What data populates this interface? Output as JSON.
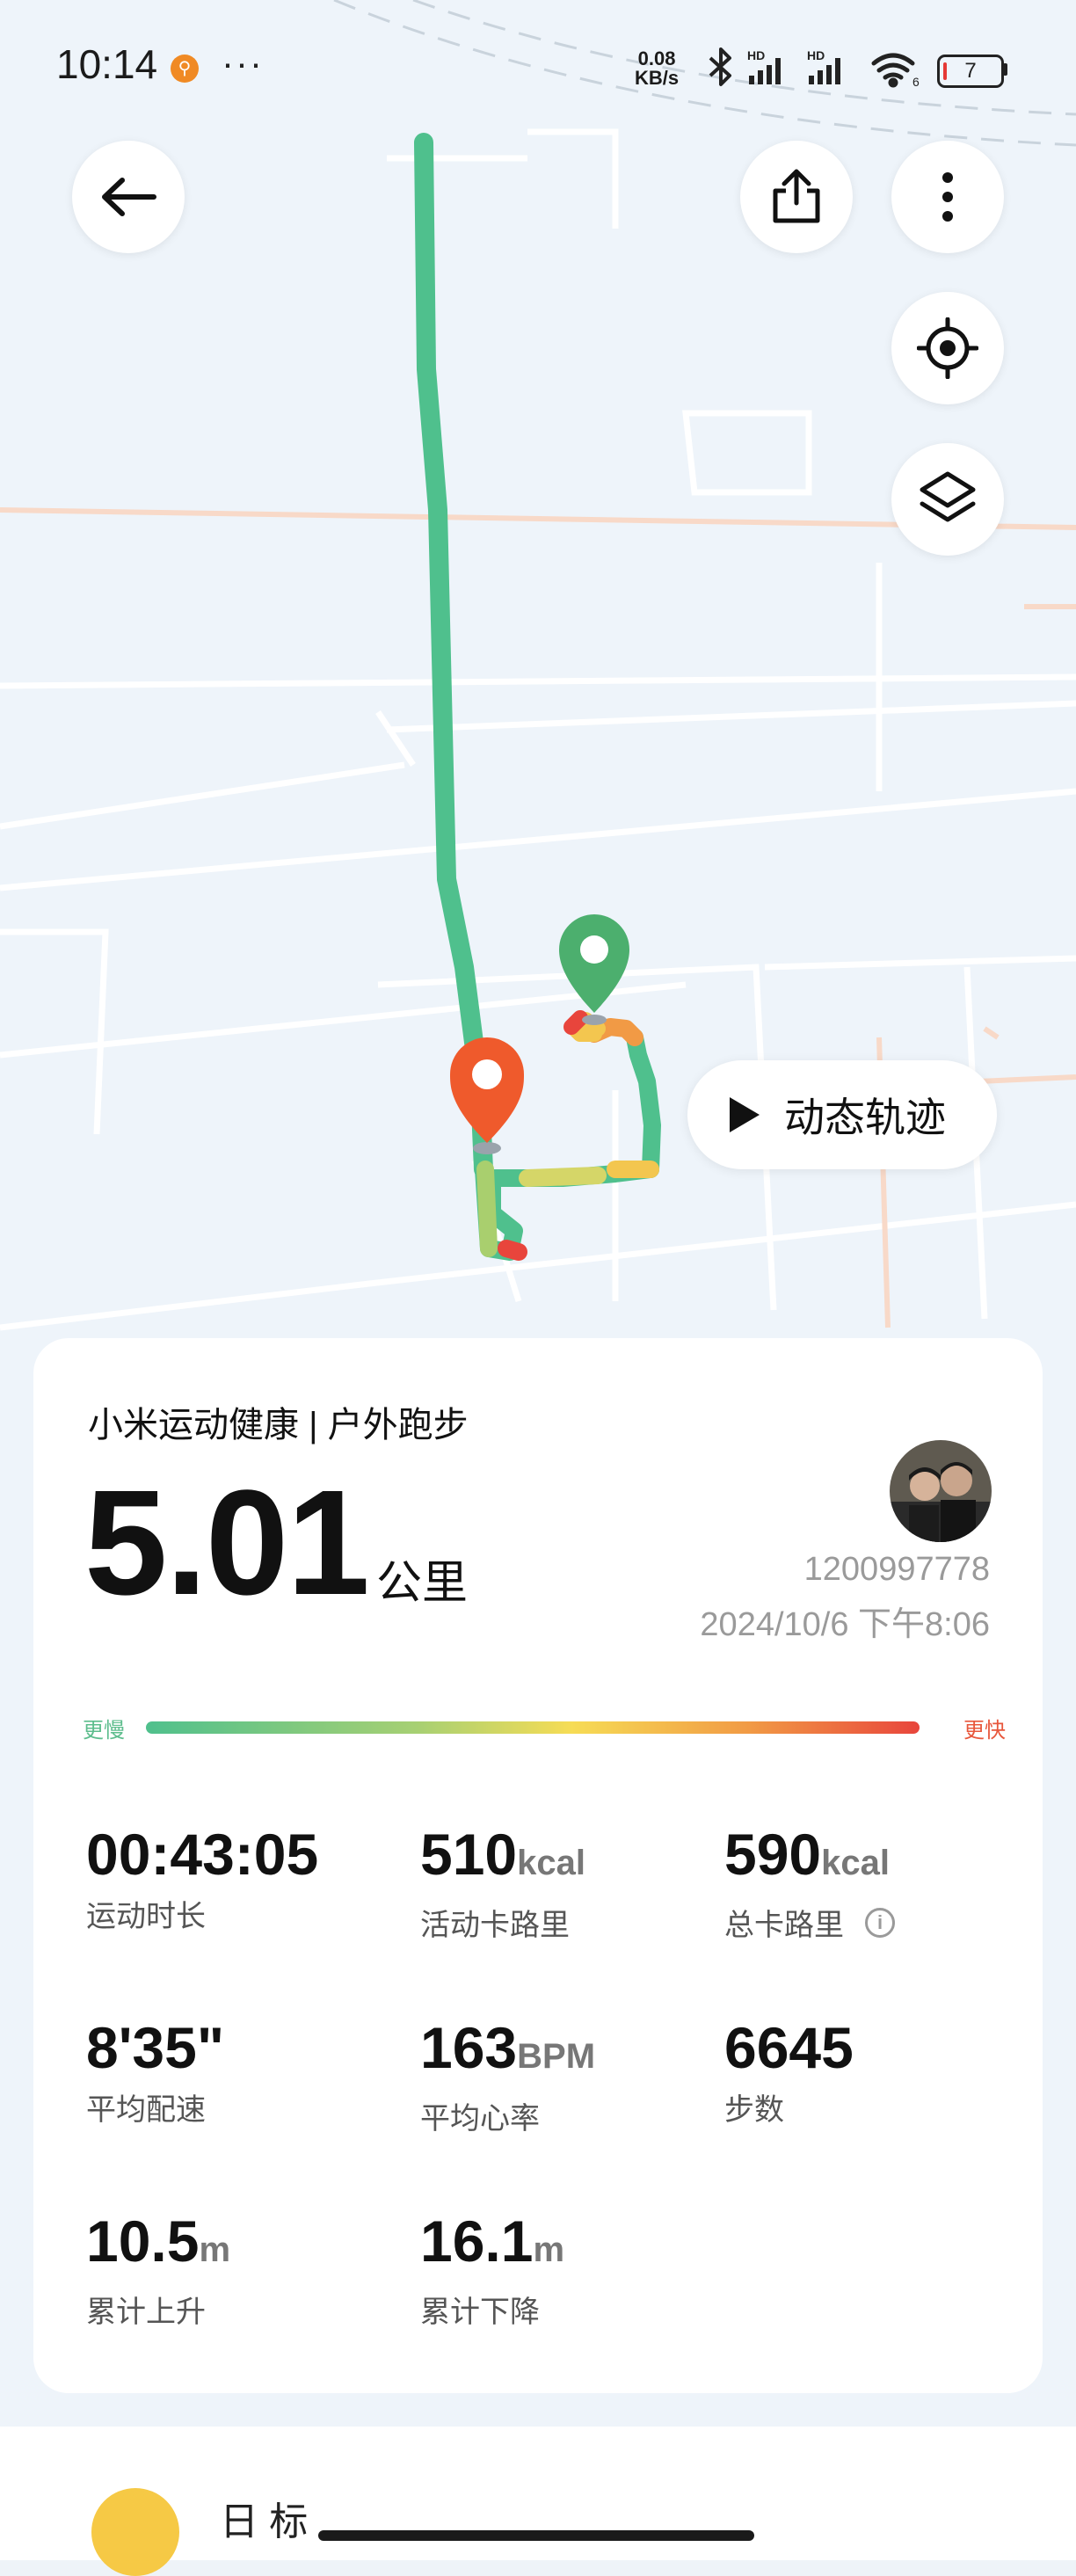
{
  "status_bar": {
    "time": "10:14",
    "net_speed_value": "0.08",
    "net_speed_unit": "KB/s",
    "battery_level": "7",
    "icons": [
      "app-notification-icon",
      "more-dots-icon",
      "bluetooth-icon",
      "signal-hd-icon",
      "signal-hd-icon",
      "wifi-icon",
      "battery-icon"
    ]
  },
  "map": {
    "dynamic_track_label": "动态轨迹",
    "buttons": [
      "back-arrow-icon",
      "share-icon",
      "more-vertical-icon",
      "locate-icon",
      "layers-icon"
    ]
  },
  "summary": {
    "title": "小米运动健康 | 户外跑步",
    "distance_value": "5.01",
    "distance_unit": "公里",
    "user_id": "1200997778",
    "datetime": "2024/10/6 下午8:06",
    "pace_slow_label": "更慢",
    "pace_fast_label": "更快"
  },
  "stats": {
    "duration": {
      "value": "00:43:05",
      "unit": "",
      "label": "运动时长"
    },
    "active_calories": {
      "value": "510",
      "unit": "kcal",
      "label": "活动卡路里"
    },
    "total_calories": {
      "value": "590",
      "unit": "kcal",
      "label": "总卡路里"
    },
    "avg_pace": {
      "value": "8'35\"",
      "unit": "",
      "label": "平均配速"
    },
    "avg_heart_rate": {
      "value": "163",
      "unit": "BPM",
      "label": "平均心率"
    },
    "steps": {
      "value": "6645",
      "unit": "",
      "label": "步数"
    },
    "elevation_gain": {
      "value": "10.5",
      "unit": "m",
      "label": "累计上升"
    },
    "elevation_loss": {
      "value": "16.1",
      "unit": "m",
      "label": "累计下降"
    }
  },
  "bottom": {
    "partial_text": "日 标"
  },
  "colors": {
    "route_green": "#4fc08d",
    "start_marker": "#4caf6e",
    "end_marker": "#ef5a2c",
    "fast": "#e8453c",
    "slow": "#4fc08d"
  }
}
